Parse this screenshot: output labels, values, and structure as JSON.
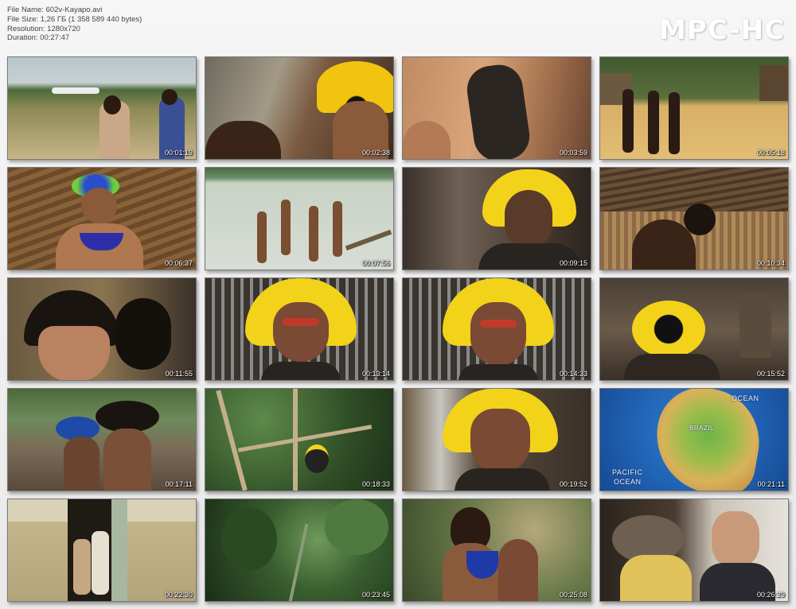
{
  "info": {
    "file_name": "File Name: 602v-Kayapo.avi",
    "file_size": "File Size: 1,26 ГБ (1 358 589 440 bytes)",
    "resolution": "Resolution: 1280x720",
    "duration": "Duration: 00:27:47"
  },
  "logo": "MPC-HC",
  "thumbnails": [
    {
      "time": "00:01:19"
    },
    {
      "time": "00:02:38"
    },
    {
      "time": "00:03:59"
    },
    {
      "time": "00:05:18"
    },
    {
      "time": "00:06:37"
    },
    {
      "time": "00:07:56"
    },
    {
      "time": "00:09:15"
    },
    {
      "time": "00:10:34"
    },
    {
      "time": "00:11:55"
    },
    {
      "time": "00:13:14"
    },
    {
      "time": "00:14:33"
    },
    {
      "time": "00:15:52"
    },
    {
      "time": "00:17:11"
    },
    {
      "time": "00:18:33"
    },
    {
      "time": "00:19:52"
    },
    {
      "time": "00:21:11"
    },
    {
      "time": "00:22:30"
    },
    {
      "time": "00:23:45"
    },
    {
      "time": "00:25:08"
    },
    {
      "time": "00:26:29"
    }
  ],
  "map_labels": {
    "ocean": "OCEAN",
    "brazil": "BRAZIL",
    "pacific_1": "PACIFIC",
    "pacific_2": "OCEAN"
  }
}
